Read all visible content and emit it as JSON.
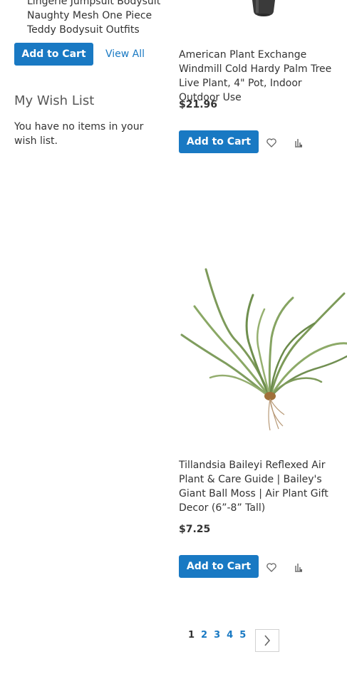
{
  "compare": {
    "product_name": "Lingerie Jumpsuit Bodysuit Naughty Mesh One Piece Teddy Bodysuit Outfits",
    "add_to_cart_label": "Add to Cart",
    "view_all_label": "View All"
  },
  "wishlist": {
    "title": "My Wish List",
    "empty_text": "You have no items in your wish list."
  },
  "products": [
    {
      "name": "American Plant Exchange Windmill Cold Hardy Palm Tree Live Plant, 4\" Pot, Indoor Outdoor Use",
      "price": "$21.96",
      "add_to_cart_label": "Add to Cart",
      "wishlist_icon": "heart-icon",
      "compare_icon": "compare-chart-icon"
    },
    {
      "name": "Tillandsia Baileyi Reflexed Air Plant & Care Guide | Bailey's Giant Ball Moss | Air Plant Gift Decor (6”-8” Tall)",
      "price": "$7.25",
      "add_to_cart_label": "Add to Cart",
      "wishlist_icon": "heart-icon",
      "compare_icon": "compare-chart-icon"
    }
  ],
  "pager": {
    "current": "1",
    "pages": [
      "2",
      "3",
      "4",
      "5"
    ],
    "next_icon": "chevron-right-icon"
  },
  "colors": {
    "accent": "#1979c3",
    "text": "#333333",
    "heading": "#575757"
  }
}
